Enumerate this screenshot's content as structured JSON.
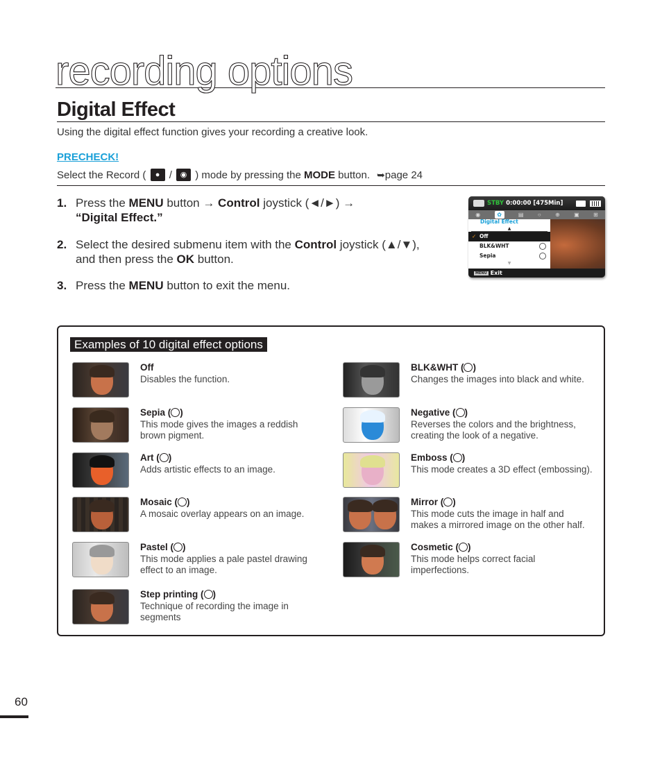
{
  "chapter_title": "recording options",
  "section_title": "Digital Effect",
  "intro": "Using the digital effect function gives your recording a creative look.",
  "precheck": {
    "label": "PRECHECK!",
    "text_before": "Select the Record ( ",
    "separator": " / ",
    "text_after": " ) mode by pressing the ",
    "mode_label": "MODE",
    "text_end": " button.",
    "page_ref": "page 24",
    "icons": [
      "movie-camera-icon",
      "photo-camera-icon"
    ]
  },
  "steps": [
    {
      "number": "1.",
      "parts": [
        "Press the ",
        "MENU",
        " button → ",
        "Control",
        " joystick (◄/►) →"
      ],
      "line2": "“Digital Effect.”"
    },
    {
      "number": "2.",
      "parts": [
        "Select the desired submenu item with the ",
        "Control",
        " joystick (▲/▼),"
      ],
      "line2_parts": [
        "and then press the ",
        "OK",
        " button."
      ]
    },
    {
      "number": "3.",
      "parts": [
        "Press the ",
        "MENU",
        " button to exit the menu."
      ]
    }
  ],
  "lcd": {
    "status": "STBY",
    "time": "0:00:00 [475Min]",
    "menu_title": "Digital Effect",
    "items": [
      {
        "label": "Off",
        "selected": true
      },
      {
        "label": "BLK&WHT",
        "selected": false
      },
      {
        "label": "Sepia",
        "selected": false
      }
    ],
    "menu_key": "MENU",
    "exit_label": "Exit"
  },
  "examples": {
    "title": "Examples of 10 digital effect options",
    "items": [
      {
        "name": "Off",
        "icon": "",
        "description": "Disables the function."
      },
      {
        "name": "BLK&WHT",
        "icon": "bw-icon",
        "description": "Changes the images into black and white."
      },
      {
        "name": "Sepia",
        "icon": "sepia-icon",
        "description": "This mode gives the images a reddish brown pigment."
      },
      {
        "name": "Negative",
        "icon": "negative-icon",
        "description": "Reverses the colors and the brightness, creating the look of a negative."
      },
      {
        "name": "Art",
        "icon": "art-icon",
        "description": "Adds artistic effects to an image."
      },
      {
        "name": "Emboss",
        "icon": "emboss-icon",
        "description": "This mode creates a 3D effect (embossing)."
      },
      {
        "name": "Mosaic",
        "icon": "mosaic-icon",
        "description": "A mosaic overlay appears on an image."
      },
      {
        "name": "Mirror",
        "icon": "mirror-icon",
        "description": "This mode cuts the image in half and makes a mirrored image on the other half."
      },
      {
        "name": "Pastel",
        "icon": "pastel-icon",
        "description": "This mode applies a pale pastel drawing effect to an image."
      },
      {
        "name": "Cosmetic",
        "icon": "cosmetic-icon",
        "description": "This mode helps correct facial imperfections."
      },
      {
        "name": "Step printing",
        "icon": "step-printing-icon",
        "description": "Technique of recording the image in segments"
      }
    ]
  },
  "page_number": "60"
}
